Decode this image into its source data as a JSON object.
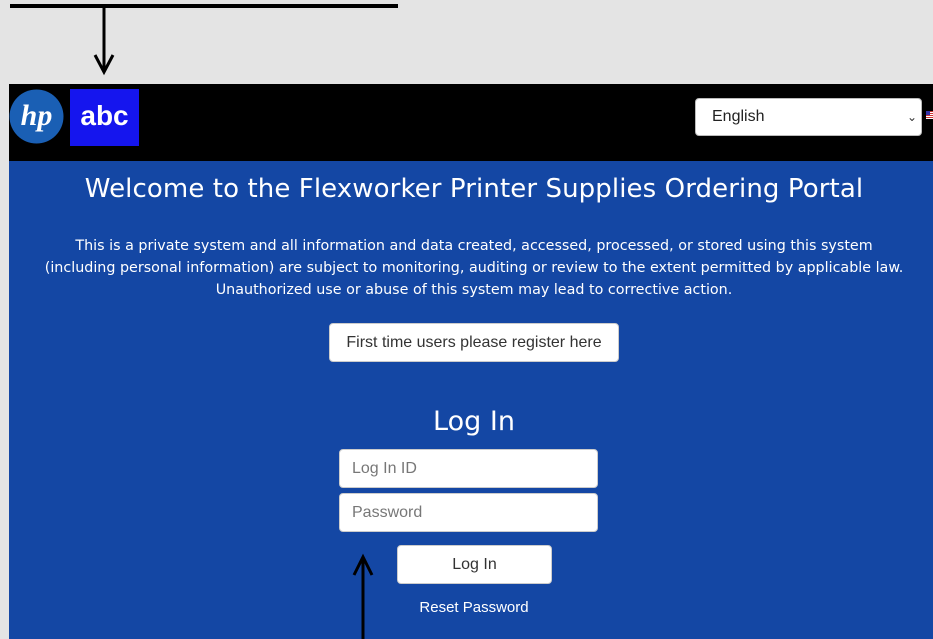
{
  "header": {
    "brand_logo_icon": "hp-logo",
    "partner_logo_text": "abc",
    "language_select": {
      "selected": "English",
      "chevron_icon": "chevron-down-icon",
      "flag_icon": "us-flag-icon"
    }
  },
  "main": {
    "title": "Welcome to the Flexworker Printer Supplies Ordering Portal",
    "notice_lines": [
      "This is a private system and all information and data created, accessed, processed, or stored using this system",
      "(including personal information) are subject to monitoring, auditing or review to the extent permitted by applicable law.",
      "Unauthorized use or abuse of this system may lead to corrective action."
    ],
    "register_button": "First time users please register here",
    "login": {
      "heading": "Log In",
      "login_id_placeholder": "Log In ID",
      "password_placeholder": "Password",
      "submit_label": "Log In",
      "reset_link": "Reset Password"
    }
  },
  "colors": {
    "page_background": "#1447a4",
    "header_background": "#000000",
    "partner_logo_background": "#1515ee",
    "outer_background": "#e4e4e4"
  }
}
